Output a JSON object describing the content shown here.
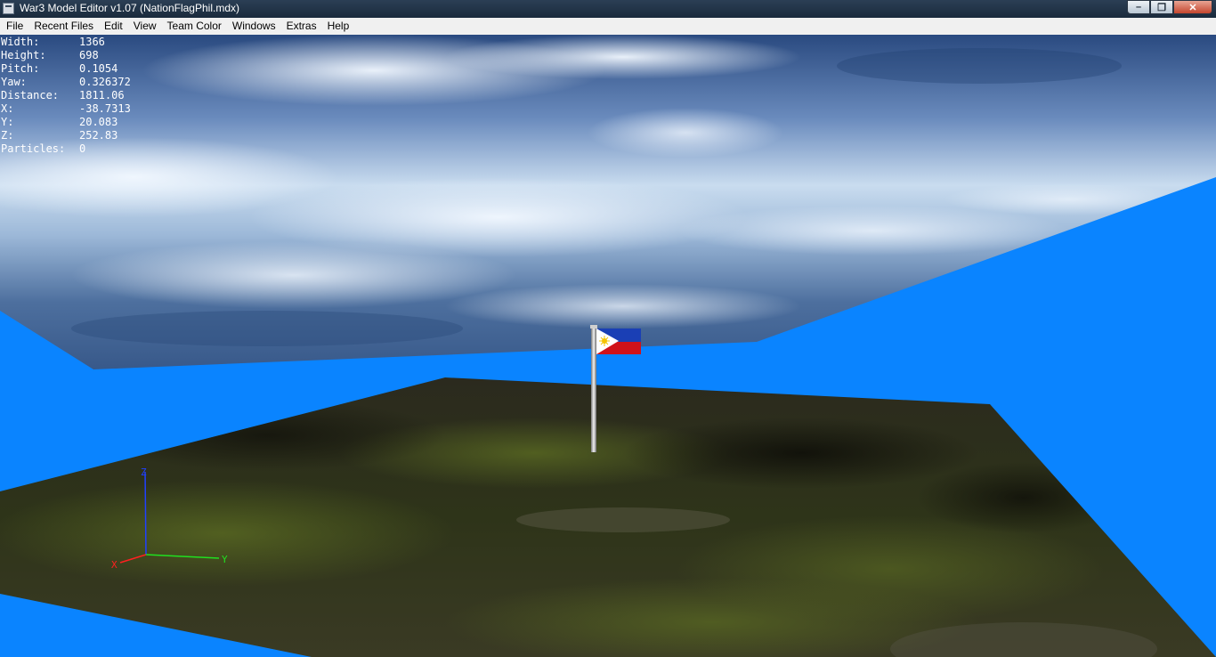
{
  "window": {
    "title": "War3 Model Editor v1.07 (NationFlagPhil.mdx)",
    "buttons": {
      "minimize_icon": "minimize-icon",
      "maximize_icon": "maximize-icon",
      "close_icon": "close-icon"
    }
  },
  "menu": {
    "items": [
      "File",
      "Recent Files",
      "Edit",
      "View",
      "Team Color",
      "Windows",
      "Extras",
      "Help"
    ]
  },
  "stats": [
    {
      "label": "Width:",
      "value": "1366"
    },
    {
      "label": "Height:",
      "value": "698"
    },
    {
      "label": "Pitch:",
      "value": "0.1054"
    },
    {
      "label": "Yaw:",
      "value": "0.326372"
    },
    {
      "label": "Distance:",
      "value": "1811.06"
    },
    {
      "label": "X:",
      "value": "-38.7313"
    },
    {
      "label": "Y:",
      "value": "20.083"
    },
    {
      "label": "Z:",
      "value": "252.83"
    },
    {
      "label": "Particles:",
      "value": "0"
    }
  ],
  "axes": {
    "x": "X",
    "y": "Y",
    "z": "Z"
  },
  "colors": {
    "background": "#0a84ff",
    "axis_x": "#ff2020",
    "axis_y": "#20e020",
    "axis_z": "#2040ff",
    "flag_blue": "#1a3fb5",
    "flag_red": "#d0121a",
    "flag_white": "#ffffff",
    "flag_sun": "#f5c400"
  }
}
